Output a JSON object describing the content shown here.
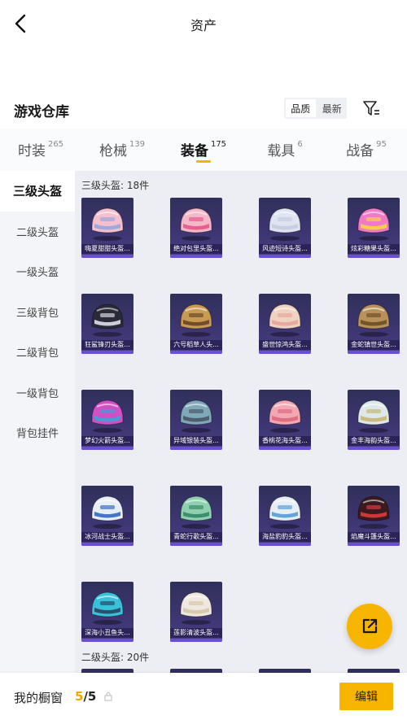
{
  "header": {
    "title": "资产"
  },
  "section": {
    "title": "游戏仓库",
    "sort_quality": "品质",
    "sort_latest": "最新"
  },
  "tabs": [
    {
      "label": "时装",
      "count": "265"
    },
    {
      "label": "枪械",
      "count": "139"
    },
    {
      "label": "装备",
      "count": "175"
    },
    {
      "label": "载具",
      "count": "6"
    },
    {
      "label": "战备",
      "count": "95"
    }
  ],
  "active_tab": 2,
  "sidebar": {
    "items": [
      "三级头盔",
      "二级头盔",
      "一级头盔",
      "三级背包",
      "二级背包",
      "一级背包",
      "背包挂件"
    ],
    "active": 0
  },
  "groups": [
    {
      "label": "三级头盔: 18件"
    },
    {
      "label": "二级头盔: 20件"
    }
  ],
  "items": [
    {
      "name": "嗨夏甜甜头盔...",
      "colors": [
        "#f4c0d0",
        "#9aa6d8"
      ]
    },
    {
      "name": "绝对包里头盔...",
      "colors": [
        "#f5b8c8",
        "#e85a8a"
      ]
    },
    {
      "name": "风迹短诗头盔...",
      "colors": [
        "#dfe4f2",
        "#c9cce0"
      ]
    },
    {
      "name": "炫彩糖果头盔...",
      "colors": [
        "#f07ac4",
        "#f6d24a"
      ]
    },
    {
      "name": "狂鲨锋刃头盔...",
      "colors": [
        "#2a2a38",
        "#d6d6e0"
      ]
    },
    {
      "name": "六号稻草人头...",
      "colors": [
        "#c99a52",
        "#6b4a2a"
      ]
    },
    {
      "name": "盛世惊鸿头盔...",
      "colors": [
        "#f0d2c0",
        "#e6a6a0"
      ]
    },
    {
      "name": "金蛇镇世头盔...",
      "colors": [
        "#b8925a",
        "#6f5228"
      ]
    },
    {
      "name": "梦幻火箭头盔...",
      "colors": [
        "#d04fc2",
        "#3fa0d8"
      ]
    },
    {
      "name": "异域银装头盔...",
      "colors": [
        "#7fa8b8",
        "#4a5a6a"
      ]
    },
    {
      "name": "香桃花海头盔...",
      "colors": [
        "#f2a8b4",
        "#e06a80"
      ]
    },
    {
      "name": "金丰海韵头盔...",
      "colors": [
        "#dde8e8",
        "#c9b67a"
      ]
    },
    {
      "name": "冰河战士头盔...",
      "colors": [
        "#e8eef6",
        "#3c6fc4"
      ]
    },
    {
      "name": "青蛇行歌头盔...",
      "colors": [
        "#8fd0b0",
        "#3a8a6a"
      ]
    },
    {
      "name": "海盐豹豹头盔...",
      "colors": [
        "#e6eef4",
        "#5aa0d8"
      ]
    },
    {
      "name": "焰魔斗篷头盔...",
      "colors": [
        "#3a1a1e",
        "#d43a3a"
      ]
    },
    {
      "name": "深海小丑鱼头...",
      "colors": [
        "#3ac0d8",
        "#2a4a6a"
      ]
    },
    {
      "name": "莲影清波头盔...",
      "colors": [
        "#efe8e0",
        "#d8c8a8"
      ]
    }
  ],
  "footer": {
    "showcase_label": "我的橱窗",
    "showcase_current": "5",
    "showcase_total": "/5",
    "edit_label": "编辑"
  },
  "accent_color": "#f7b500"
}
